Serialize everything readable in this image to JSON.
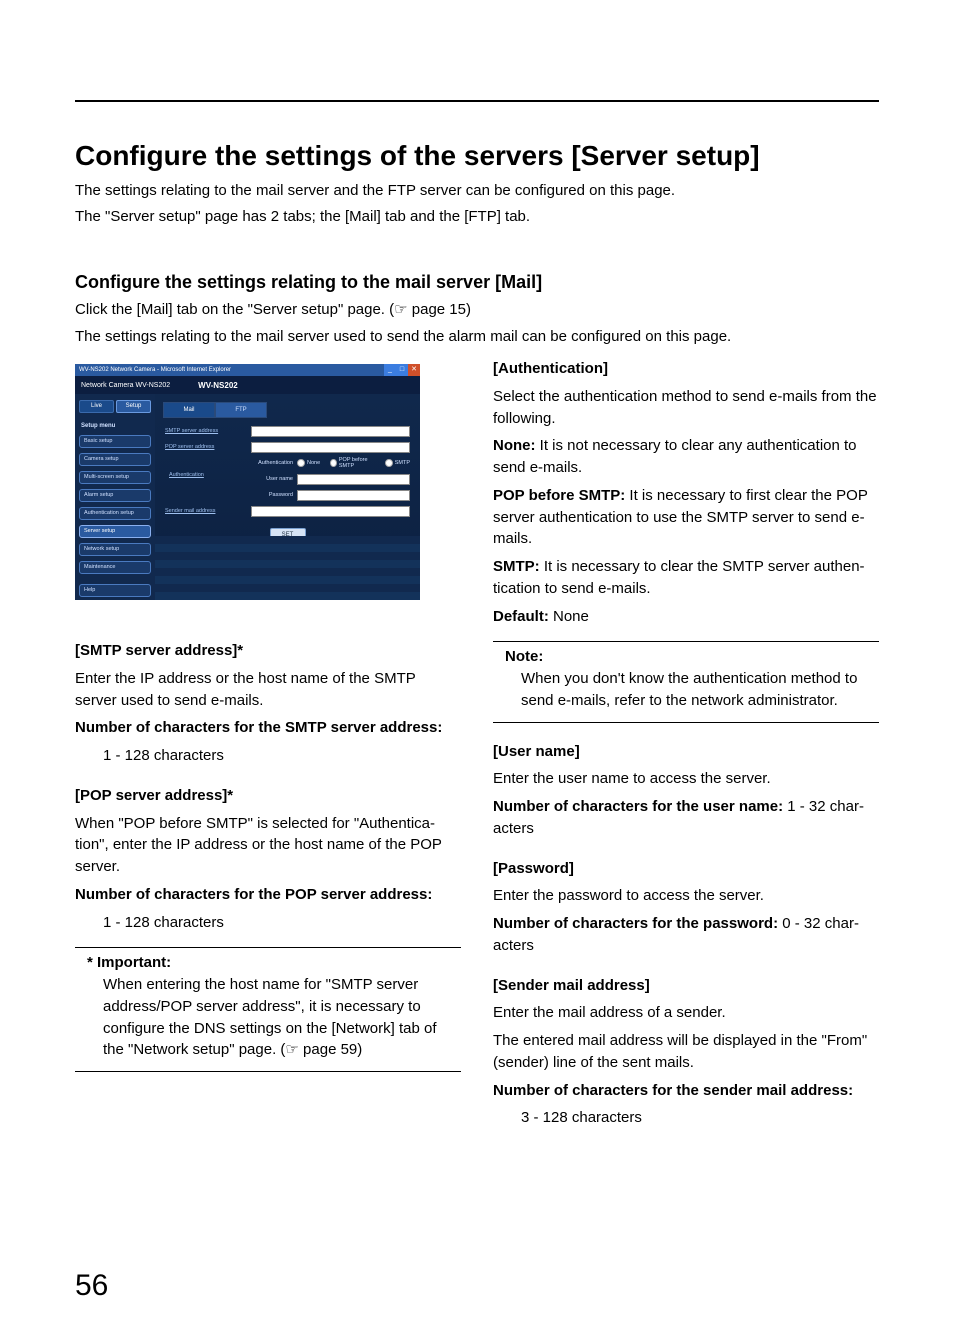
{
  "heading": "Configure the settings of the servers [Server setup]",
  "intro1": "The settings relating to the mail server and the FTP server can be configured on this page.",
  "intro2": "The \"Server setup\" page has 2 tabs; the [Mail] tab and the [FTP] tab.",
  "sub": "Configure the settings relating to the mail server [Mail]",
  "subline_a": "Click the [Mail] tab on the \"Server setup\" page. (",
  "subline_ref": "☞ page 15",
  "subline_b": ")",
  "subline2": "The settings relating to the mail server used to send the alarm mail can be configured on this page.",
  "shot": {
    "title": "WV-NS202 Network Camera - Microsoft Internet Explorer",
    "brand_small": "Network Camera",
    "brand_model_a": "WV-NS202",
    "brand_model_b": "WV-NS202",
    "toptabs": {
      "live": "Live",
      "setup": "Setup"
    },
    "menu_title": "Setup menu",
    "menu": [
      "Basic setup",
      "Camera setup",
      "Multi-screen setup",
      "Alarm setup",
      "Authentication setup",
      "Server setup",
      "Network setup",
      "Maintenance"
    ],
    "menu_help": "Help",
    "tabs": {
      "mail": "Mail",
      "ftp": "FTP"
    },
    "rows": {
      "smtp": "SMTP server address",
      "pop": "POP server address",
      "auth_group": "Authentication",
      "auth": "Authentication",
      "user": "User name",
      "pass": "Password",
      "sender": "Sender mail address"
    },
    "radios": {
      "none": "None",
      "pbs": "POP before SMTP",
      "smtp": "SMTP"
    },
    "set": "SET"
  },
  "left": {
    "smtp_h": "[SMTP server address]*",
    "smtp_p": "Enter the IP address or the host name of the SMTP server used to send e-mails.",
    "smtp_n_lbl": "Number of characters for the SMTP server address:",
    "smtp_n_val": "1 - 128 characters",
    "pop_h": "[POP server address]*",
    "pop_p": "When \"POP before SMTP\" is selected for \"Authentica­tion\", enter the IP address or the host name of the POP server.",
    "pop_n_lbl": "Number of characters for the POP server address:",
    "pop_n_val": "1 - 128 characters",
    "imp_h": "* Important:",
    "imp_p_a": "When entering the host name for \"SMTP server address/POP server address\", it is necessary to configure the DNS settings on the [Network] tab of the \"Network setup\" page. (",
    "imp_ref": "☞ page 59",
    "imp_p_b": ")"
  },
  "right": {
    "auth_h": "[Authentication]",
    "auth_p": "Select the authentication method to send e-mails from the following.",
    "auth_none_lbl": "None:",
    "auth_none_txt": " It is not necessary to clear any authentication to send e-mails.",
    "auth_pbs_lbl": "POP before SMTP:",
    "auth_pbs_txt": " It is necessary to first clear the POP server authentication to use the SMTP server to send e-mails.",
    "auth_smtp_lbl": "SMTP:",
    "auth_smtp_txt": " It is necessary to clear the SMTP server authen­tication to send e-mails.",
    "auth_def_lbl": "Default:",
    "auth_def_txt": " None",
    "note_h": "Note:",
    "note_p": "When you don't know the authentication method to send e-mails, refer to the network administrator.",
    "user_h": "[User name]",
    "user_p": "Enter the user name to access the server.",
    "user_n_lbl": "Number of characters for the user name:",
    "user_n_val": " 1 - 32 char­acters",
    "pass_h": "[Password]",
    "pass_p": "Enter the password to access the server.",
    "pass_n_lbl": "Number of characters for the password:",
    "pass_n_val": " 0 - 32 char­acters",
    "sender_h": "[Sender mail address]",
    "sender_p1": "Enter the mail address of a sender.",
    "sender_p2": "The entered mail address will be displayed in the \"From\" (sender) line of the sent mails.",
    "sender_n_lbl": "Number of characters for the sender mail address:",
    "sender_n_val": "3 - 128 characters"
  },
  "page_number": "56"
}
